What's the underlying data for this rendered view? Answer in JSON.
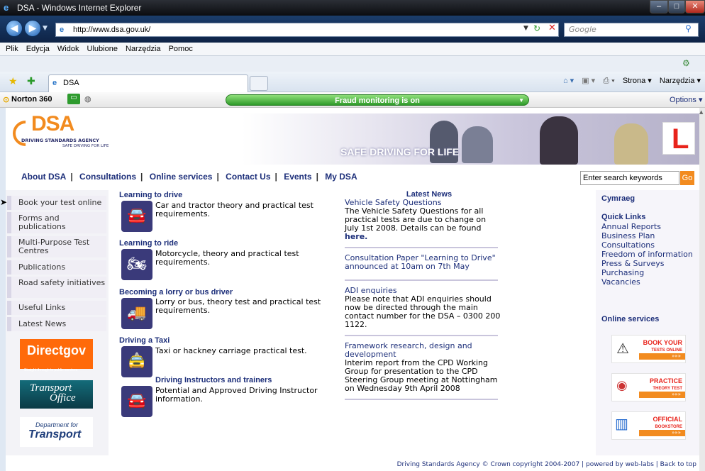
{
  "window": {
    "title": "DSA - Windows Internet Explorer",
    "minimize": "–",
    "maximize": "□",
    "close": "✕"
  },
  "browser": {
    "url": "http://www.dsa.gov.uk/",
    "search_placeholder": "Google",
    "menu": [
      "Plik",
      "Edycja",
      "Widok",
      "Ulubione",
      "Narzędzia",
      "Pomoc"
    ],
    "tab_label": "DSA",
    "tab_cmds": [
      "Strona ▾",
      "Narzędzia ▾"
    ],
    "norton_label": "Norton 360",
    "fraud": "Fraud monitoring is on",
    "options": "Options ▾"
  },
  "site": {
    "logo_text": "DSA",
    "logo_sub": "DRIVING STANDARDS AGENCY",
    "logo_tag": "SAFE DRIVING FOR LIFE",
    "banner_text": "SAFE DRIVING FOR LIFE",
    "l_plate": "L",
    "nav": [
      "About DSA",
      "Consultations",
      "Online services",
      "Contact Us",
      "Events",
      "My DSA"
    ],
    "search_placeholder": "Enter search keywords",
    "go": "Go",
    "left_menu": [
      "Book your test online",
      "Forms and publications",
      "Multi-Purpose Test Centres",
      "Publications",
      "Road safety initiatives",
      "Useful Links",
      "Latest News"
    ],
    "logos": {
      "directgov": "Directgov",
      "directgov_tag": "Straight through to public services",
      "transport_office_1": "Transport",
      "transport_office_2": "Office",
      "dft_1": "Department for",
      "dft_2": "Transport"
    },
    "sections": [
      {
        "title": "Learning to drive",
        "desc": "Car and tractor theory and practical test requirements.",
        "icon": "car-icon",
        "glyph": "🚘"
      },
      {
        "title": "Learning to ride",
        "desc": "Motorcycle, theory and practical test requirements.",
        "icon": "motorcycle-icon",
        "glyph": "🏍"
      },
      {
        "title": "Becoming a lorry or bus driver",
        "desc": "Lorry or bus, theory test and practical test requirements.",
        "icon": "lorry-icon",
        "glyph": "🚚"
      },
      {
        "title": "Driving a Taxi",
        "desc": "Taxi or hackney carriage practical test.",
        "icon": "taxi-icon",
        "glyph": "🚖"
      },
      {
        "title": "Driving Instructors and trainers",
        "desc": "Potential and Approved Driving Instructor information.",
        "icon": "instructor-icon",
        "glyph": "🚘"
      }
    ],
    "news": {
      "heading": "Latest News",
      "items": [
        {
          "title": "Vehicle Safety Questions",
          "body": "The Vehicle Safety Questions for all practical tests are due to change on July 1st 2008. Details can be found",
          "link": "here."
        },
        {
          "title": "Consultation Paper \"Learning to Drive\" announced at 10am on 7th May",
          "body": ""
        },
        {
          "title": "ADI enquiries",
          "body": "Please note that ADI enquiries should now be directed through the main contact number for the DSA – 0300 200 1122."
        },
        {
          "title": "Framework research, design and development",
          "body": "Interim report from the CPD Working Group for presentation to the CPD Steering Group meeting at Nottingham on Wednesday 9th April 2008"
        }
      ]
    },
    "right": {
      "cymraeg": "Cymraeg",
      "quick_links_title": "Quick Links",
      "quick_links": [
        "Annual Reports",
        "Business Plan",
        "Consultations",
        "Freedom of information",
        "Press & Surveys",
        "Purchasing",
        "Vacancies"
      ],
      "online_title": "Online services",
      "online": [
        {
          "l1": "BOOK YOUR",
          "l2": "TESTS ONLINE"
        },
        {
          "l1": "PRACTICE",
          "l2": "THEORY TEST"
        },
        {
          "l1": "OFFICIAL",
          "l2": "BOOKSTORE"
        }
      ],
      "arrows": "»»»"
    },
    "footer": "Driving Standards Agency © Crown copyright 2004-2007 | powered by web-labs | Back to top"
  }
}
